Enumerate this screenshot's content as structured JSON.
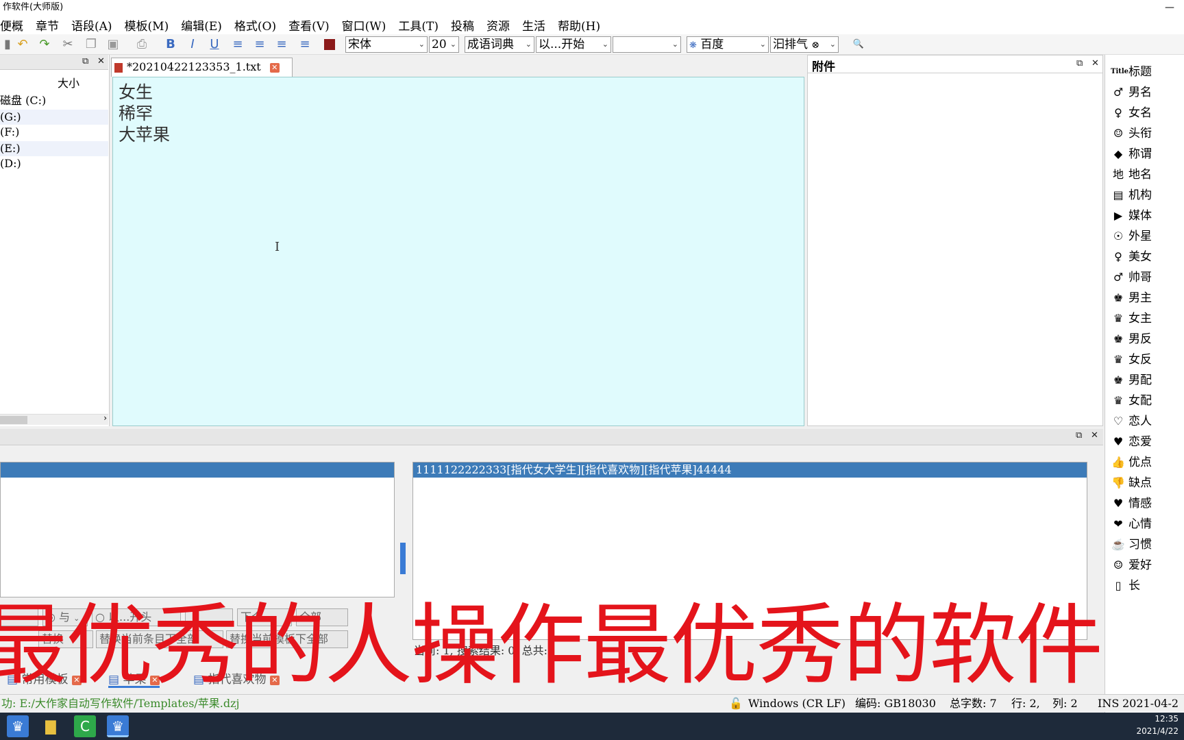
{
  "window": {
    "title": "作软件(大师版)"
  },
  "menu": [
    "便概",
    "章节",
    "语段(A)",
    "模板(M)",
    "编辑(E)",
    "格式(O)",
    "查看(V)",
    "窗口(W)",
    "工具(T)",
    "投稿",
    "资源",
    "生活",
    "帮助(H)"
  ],
  "toolbar": {
    "font": "宋体",
    "size": "20",
    "dictionary": "成语词典",
    "match_mode": "以...开始",
    "search_input": "",
    "engine": "百度",
    "keyword": "汩排气",
    "accent": "#8b1a1a"
  },
  "left_panel": {
    "column_header": "大小",
    "drives": [
      "磁盘 (C:)",
      "(G:)",
      "(F:)",
      "(E:)",
      "(D:)"
    ]
  },
  "editor": {
    "tab_title": "*20210422123353_1.txt",
    "lines": [
      "女生",
      "稀罕",
      "大苹果"
    ],
    "bg": "#e0fbfd"
  },
  "attachments": {
    "title": "附件"
  },
  "categories": [
    {
      "label": "标题",
      "icon": "Title"
    },
    {
      "label": "男名",
      "icon": "♂"
    },
    {
      "label": "女名",
      "icon": "♀"
    },
    {
      "label": "头衔",
      "icon": "☺"
    },
    {
      "label": "称谓",
      "icon": "◆"
    },
    {
      "label": "地名",
      "icon": "地"
    },
    {
      "label": "机构",
      "icon": "▤"
    },
    {
      "label": "媒体",
      "icon": "▶"
    },
    {
      "label": "外星",
      "icon": "☉"
    },
    {
      "label": "美女",
      "icon": "♀"
    },
    {
      "label": "帅哥",
      "icon": "♂"
    },
    {
      "label": "男主",
      "icon": "♚"
    },
    {
      "label": "女主",
      "icon": "♛"
    },
    {
      "label": "男反",
      "icon": "♚"
    },
    {
      "label": "女反",
      "icon": "♛"
    },
    {
      "label": "男配",
      "icon": "♚"
    },
    {
      "label": "女配",
      "icon": "♛"
    },
    {
      "label": "恋人",
      "icon": "♡"
    },
    {
      "label": "恋爱",
      "icon": "♥"
    },
    {
      "label": "优点",
      "icon": "👍"
    },
    {
      "label": "缺点",
      "icon": "👎"
    },
    {
      "label": "情感",
      "icon": "♥"
    },
    {
      "label": "心情",
      "icon": "❤"
    },
    {
      "label": "习惯",
      "icon": "☕"
    },
    {
      "label": "爱好",
      "icon": "☺"
    },
    {
      "label": "长",
      "icon": "▯"
    }
  ],
  "results": {
    "right_selected": "1111122222333[指代女大学生][指代喜欢物][指代苹果]44444",
    "status": "当前: 1, 搜索结果: 0, 总共:"
  },
  "controls": {
    "and_label": "与",
    "start_label": "以...开头",
    "next_label": "下个",
    "all_label": "全部",
    "replace_label": "替换",
    "replace_current_label": "替换当前条目下全部",
    "replace_template_label": "替换当前模板下全部"
  },
  "doc_tabs": [
    "常用模板",
    "苹果",
    "指代喜欢物"
  ],
  "statusbar": {
    "path": "功: E:/大作家自动写作软件/Templates/苹果.dzj",
    "lineend": "Windows (CR LF)",
    "encoding": "编码: GB18030",
    "word_count": "总字数: 7",
    "row": "行: 2,",
    "col": "列: 2",
    "mode": "INS",
    "date": "2021-04-2"
  },
  "taskbar": {
    "time": "12:35",
    "date": "2021/4/22"
  },
  "overlay_caption": "最优秀的人操作最优秀的软件"
}
